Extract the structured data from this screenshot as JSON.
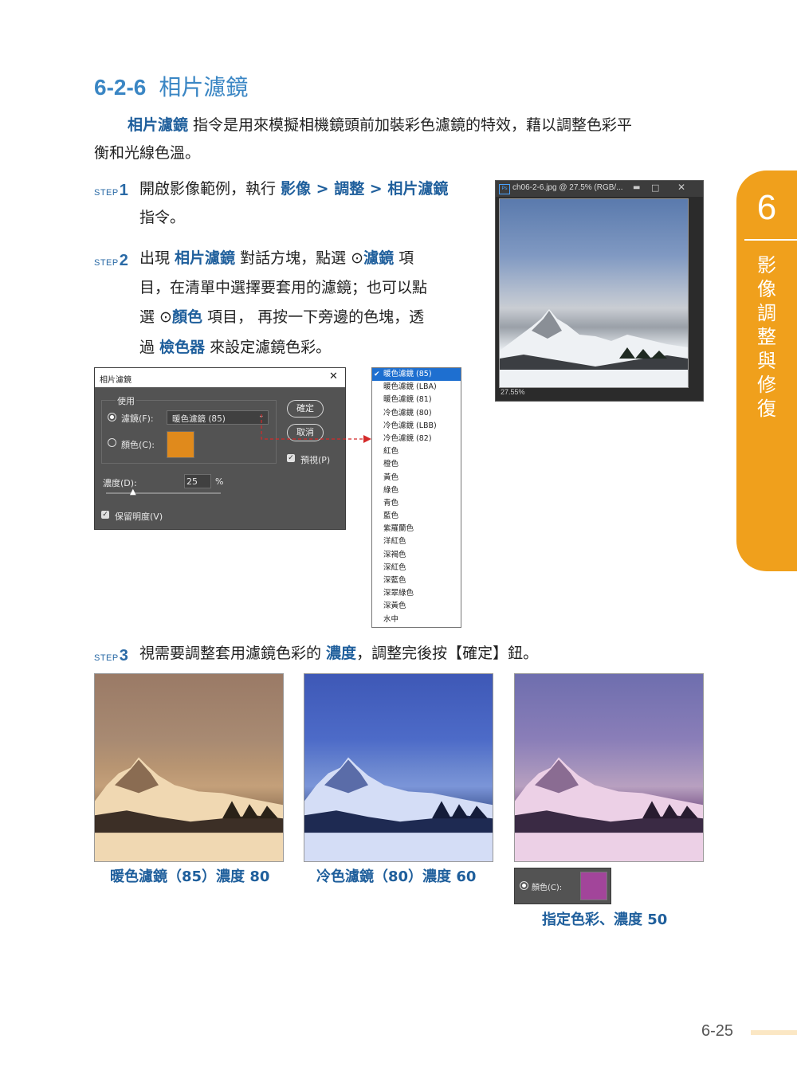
{
  "heading": {
    "number": "6-2-6",
    "title": "相片濾鏡"
  },
  "intro": {
    "line1_term": "相片濾鏡",
    "line1_text": " 指令是用來模擬相機鏡頭前加裝彩色濾鏡的特效，藉以調整色彩平",
    "line2_text": "衡和光線色溫。"
  },
  "steps": {
    "step_label": "STEP",
    "s1_num": "1",
    "s1_a": "開啟影像範例，執行 ",
    "s1_path": "影像 > 調整 > 相片濾鏡",
    "s1_b": "指令。",
    "s2_num": "2",
    "s2_l1_a": "出現 ",
    "s2_l1_term": "相片濾鏡",
    "s2_l1_b": " 對話方塊，點選 ⊙",
    "s2_l1_term2": "濾鏡",
    "s2_l1_c": " 項",
    "s2_l2": "目，在清單中選擇要套用的濾鏡；也可以點",
    "s2_l3_a": "選 ⊙",
    "s2_l3_term": "顏色",
    "s2_l3_b": " 項目， 再按一下旁邊的色塊，透",
    "s2_l4_a": "過 ",
    "s2_l4_term": "檢色器",
    "s2_l4_b": " 來設定濾鏡色彩。",
    "s3_num": "3",
    "s3_a": "視需要調整套用濾鏡色彩的 ",
    "s3_term": "濃度",
    "s3_b": "，調整完後按【確定】鈕。"
  },
  "tab": {
    "number": "6",
    "chars": [
      "影",
      "像",
      "調",
      "整",
      "與",
      "修",
      "復"
    ]
  },
  "ps_window": {
    "title": "ch06-2-6.jpg @ 27.5% (RGB/...",
    "zoom": "27.55%",
    "ps_icon": "Ps"
  },
  "dialog": {
    "title": "相片濾鏡",
    "group_label": "使用",
    "filter_label": "濾鏡(F):",
    "filter_value": "暖色濾鏡 (85)",
    "color_label": "顏色(C):",
    "swatch_color": "#e08a1c",
    "ok": "確定",
    "cancel": "取消",
    "preview": "預視(P)",
    "density_label": "濃度(D):",
    "density_value": "25",
    "density_unit": "%",
    "preserve": "保留明度(V)"
  },
  "dropdown": {
    "items": [
      "暖色濾鏡 (85)",
      "暖色濾鏡 (LBA)",
      "暖色濾鏡 (81)",
      "冷色濾鏡 (80)",
      "冷色濾鏡 (LBB)",
      "冷色濾鏡 (82)",
      "紅色",
      "橙色",
      "黃色",
      "綠色",
      "青色",
      "藍色",
      "紫羅蘭色",
      "洋紅色",
      "深褐色",
      "深紅色",
      "深藍色",
      "深翠綠色",
      "深黃色",
      "水中"
    ]
  },
  "captions": {
    "warm": "暖色濾鏡（85）濃度 80",
    "cool": "冷色濾鏡（80）濃度 60",
    "custom_label": "顏色(C):",
    "custom": "指定色彩、濃度 50",
    "custom_swatch": "#a2459a"
  },
  "page_number": "6-25"
}
